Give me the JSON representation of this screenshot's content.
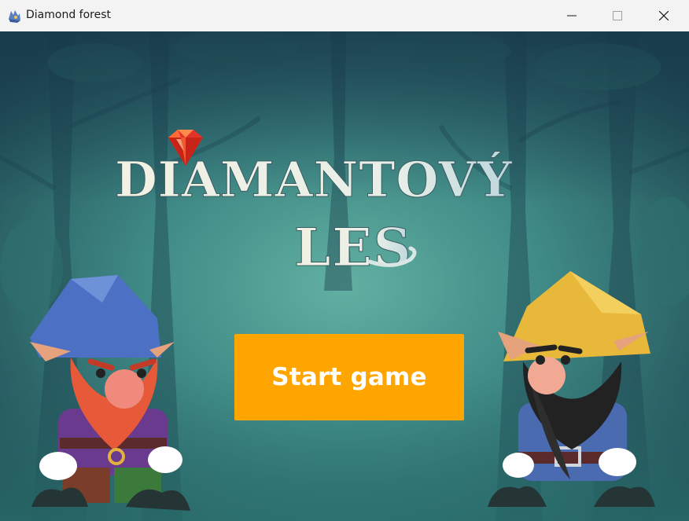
{
  "window": {
    "title": "Diamond forest",
    "controls": {
      "minimize_icon": "minimize-icon",
      "maximize_icon": "maximize-icon",
      "close_icon": "close-icon"
    }
  },
  "game": {
    "logo_line1": "DIAMANTOVÝ",
    "logo_line2": "LES",
    "start_button_label": "Start game",
    "colors": {
      "start_button": "#fea500",
      "background": "#3f8a86",
      "logo_text": "#eef1e8"
    },
    "characters": [
      "red-bearded-gnome",
      "black-bearded-gnome"
    ]
  }
}
